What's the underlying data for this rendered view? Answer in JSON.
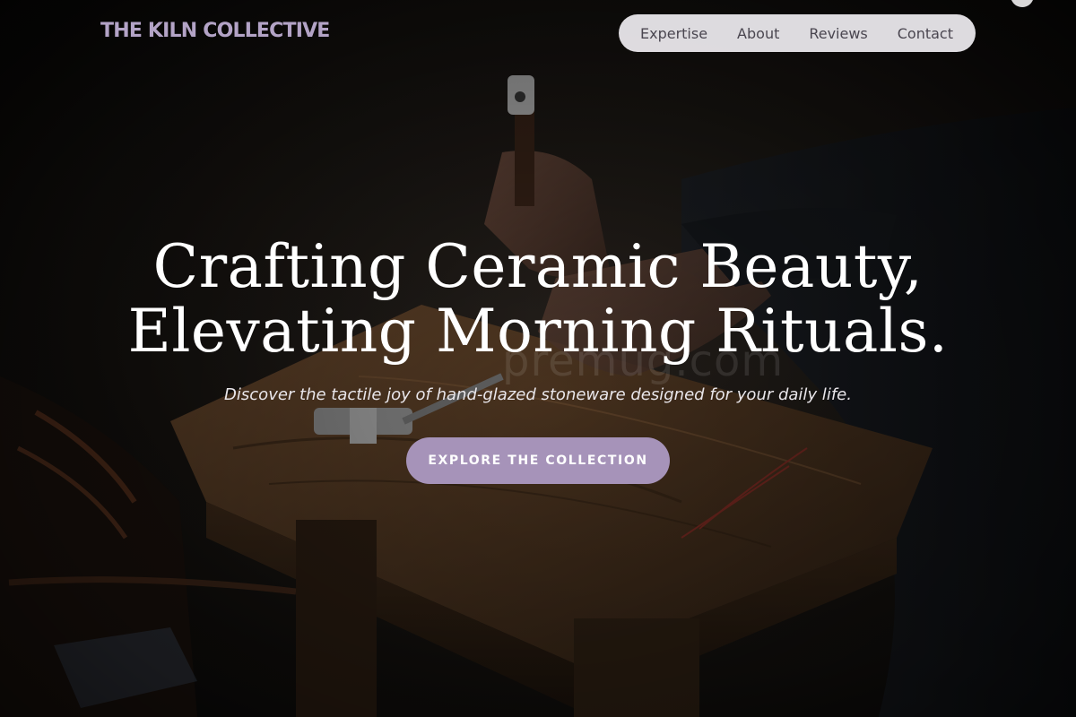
{
  "brand": {
    "name": "THE KILN COLLECTIVE"
  },
  "nav": {
    "items": [
      {
        "label": "Expertise"
      },
      {
        "label": "About"
      },
      {
        "label": "Reviews"
      },
      {
        "label": "Contact"
      }
    ]
  },
  "hero": {
    "headline_line1": "Crafting Ceramic Beauty,",
    "headline_line2": "Elevating Morning Rituals.",
    "subheadline": "Discover the tactile joy of hand-glazed stoneware designed for your daily life.",
    "cta_label": "EXPLORE THE COLLECTION",
    "background_image": "artisan-workbench-hammer-photo",
    "watermark": "premug.com"
  },
  "colors": {
    "accent": "#a693b9",
    "brand_text": "#b3a3c6",
    "nav_bg": "#eeecf0",
    "nav_text": "#4a4650",
    "headline": "#ffffff"
  }
}
